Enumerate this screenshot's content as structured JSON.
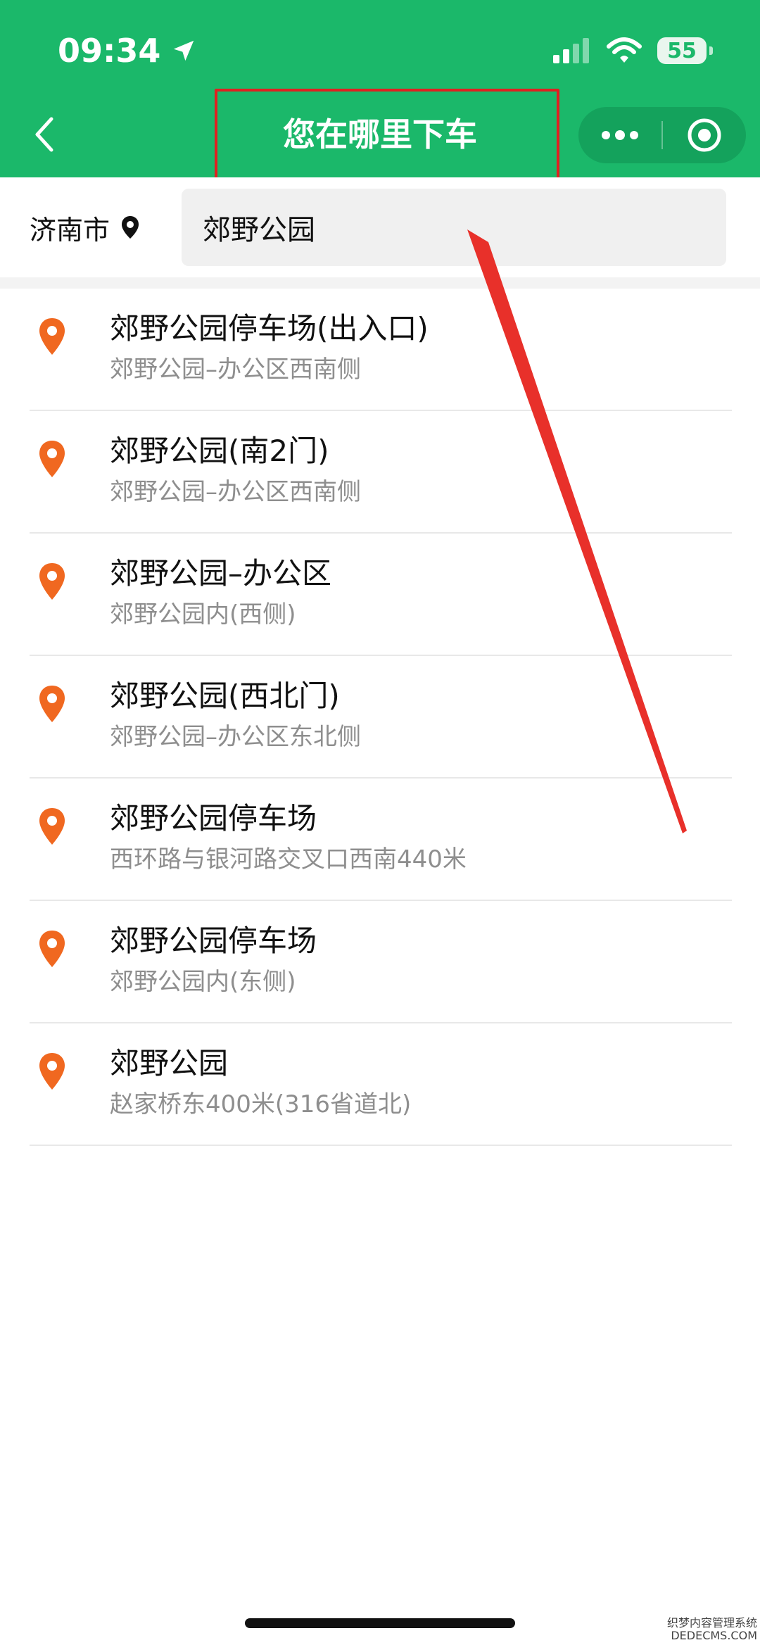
{
  "status_bar": {
    "time": "09:34",
    "battery": "55",
    "location_icon": "location-arrow-icon",
    "signal_icon": "signal-bars-icon",
    "wifi_icon": "wifi-icon"
  },
  "nav": {
    "title": "您在哪里下车",
    "back_icon": "chevron-left-icon",
    "more_icon": "more-dots-icon",
    "close_icon": "target-circle-icon"
  },
  "search": {
    "city": "济南市",
    "city_icon": "location-pin-icon",
    "value": "郊野公园"
  },
  "results": [
    {
      "name": "郊野公园停车场(出入口)",
      "address": "郊野公园–办公区西南侧"
    },
    {
      "name": "郊野公园(南2门)",
      "address": "郊野公园–办公区西南侧"
    },
    {
      "name": "郊野公园–办公区",
      "address": "郊野公园内(西侧)"
    },
    {
      "name": "郊野公园(西北门)",
      "address": "郊野公园–办公区东北侧"
    },
    {
      "name": "郊野公园停车场",
      "address": "西环路与银河路交叉口西南440米"
    },
    {
      "name": "郊野公园停车场",
      "address": "郊野公园内(东侧)"
    },
    {
      "name": "郊野公园",
      "address": "赵家桥东400米(316省道北)"
    }
  ],
  "colors": {
    "header_green": "#1bb86a",
    "pin_orange": "#f06820",
    "annotation_red": "#e02020"
  },
  "watermark": {
    "line1": "织梦内容管理系统",
    "line2": "DEDECMS.COM"
  }
}
